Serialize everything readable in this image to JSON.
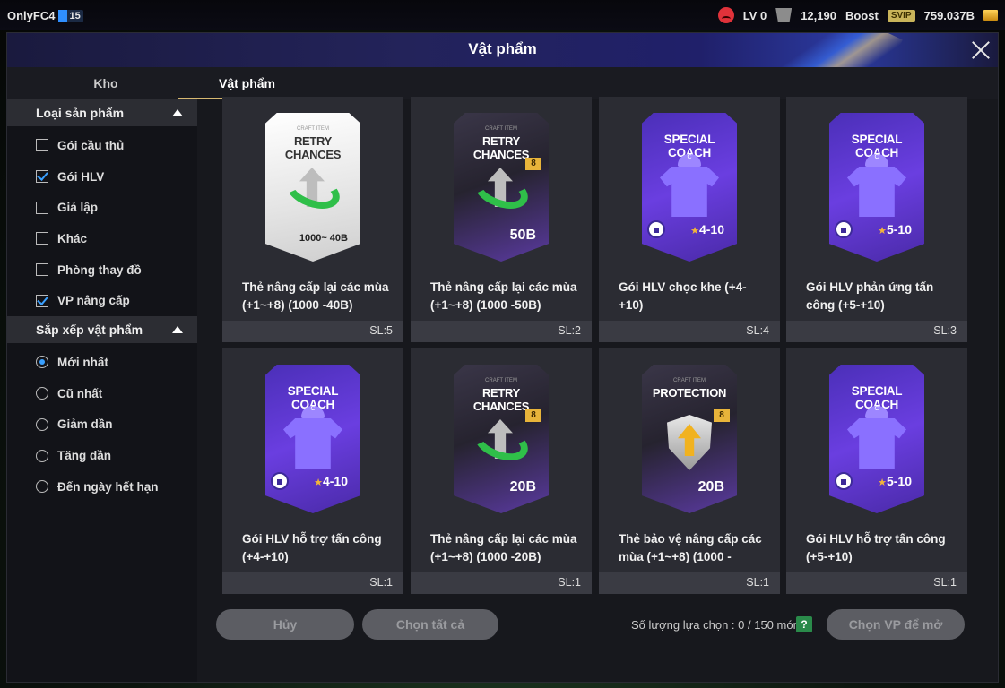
{
  "topbar": {
    "username": "OnlyFC4",
    "level_badge": "15",
    "lv": "LV 0",
    "points": "12,190",
    "boost": "Boost",
    "svip": "SVIP",
    "coins": "759.037B"
  },
  "panel": {
    "title": "Vật phẩm",
    "tabs": [
      "Kho",
      "Vật phẩm"
    ]
  },
  "sidebar": {
    "type_heading": "Loại sản phẩm",
    "types": [
      {
        "label": "Gói cầu thủ",
        "checked": false
      },
      {
        "label": "Gói HLV",
        "checked": true
      },
      {
        "label": "Giả lập",
        "checked": false
      },
      {
        "label": "Khác",
        "checked": false
      },
      {
        "label": "Phòng thay đồ",
        "checked": false
      },
      {
        "label": "VP nâng cấp",
        "checked": true
      }
    ],
    "sort_heading": "Sắp xếp vật phẩm",
    "sorts": [
      {
        "label": "Mới nhất",
        "selected": true
      },
      {
        "label": "Cũ nhất",
        "selected": false
      },
      {
        "label": "Giảm dần",
        "selected": false
      },
      {
        "label": "Tăng dần",
        "selected": false
      },
      {
        "label": "Đến ngày hết hạn",
        "selected": false
      }
    ]
  },
  "items": [
    {
      "name": "Thẻ nâng cấp lại các mùa (+1~+8) (1000 -40B)",
      "qty": "SL:5",
      "card_style": "white",
      "card_sub": "CRAFT ITEM",
      "card_title": "RETRY CHANCES",
      "card_value": "1000~ 40B"
    },
    {
      "name": "Thẻ nâng cấp lại các mùa (+1~+8) (1000 -50B)",
      "qty": "SL:2",
      "card_style": "dark",
      "card_sub": "CRAFT ITEM",
      "card_title": "RETRY CHANCES",
      "card_value": "50B",
      "badge": "8"
    },
    {
      "name": "Gói HLV chọc khe (+4-+10)",
      "qty": "SL:4",
      "card_style": "purple",
      "card_title": "SPECIAL COACH",
      "card_value": "4-10"
    },
    {
      "name": "Gói HLV phản ứng tấn công (+5-+10)",
      "qty": "SL:3",
      "card_style": "purple",
      "card_title": "SPECIAL COACH",
      "card_value": "5-10"
    },
    {
      "name": "Gói HLV hỗ trợ tấn công (+4-+10)",
      "qty": "SL:1",
      "card_style": "purple",
      "card_title": "SPECIAL COACH",
      "card_value": "4-10"
    },
    {
      "name": "Thẻ nâng cấp lại các mùa (+1~+8) (1000 -20B)",
      "qty": "SL:1",
      "card_style": "dark",
      "card_sub": "CRAFT ITEM",
      "card_title": "RETRY CHANCES",
      "card_value": "20B",
      "badge": "8"
    },
    {
      "name": "Thẻ bảo vệ nâng cấp các mùa (+1~+8) (1000 -",
      "qty": "SL:1",
      "card_style": "dark",
      "card_sub": "CRAFT ITEM",
      "card_title": "PROTECTION",
      "card_value": "20B",
      "badge": "8"
    },
    {
      "name": "Gói HLV hỗ trợ tấn công (+5-+10)",
      "qty": "SL:1",
      "card_style": "purple",
      "card_title": "SPECIAL COACH",
      "card_value": "5-10"
    }
  ],
  "footer": {
    "cancel": "Hủy",
    "select_all": "Chọn tất cả",
    "count_label": "Số lượng lựa chọn : 0 / 150 món",
    "help": "?",
    "open": "Chọn VP để mở"
  }
}
